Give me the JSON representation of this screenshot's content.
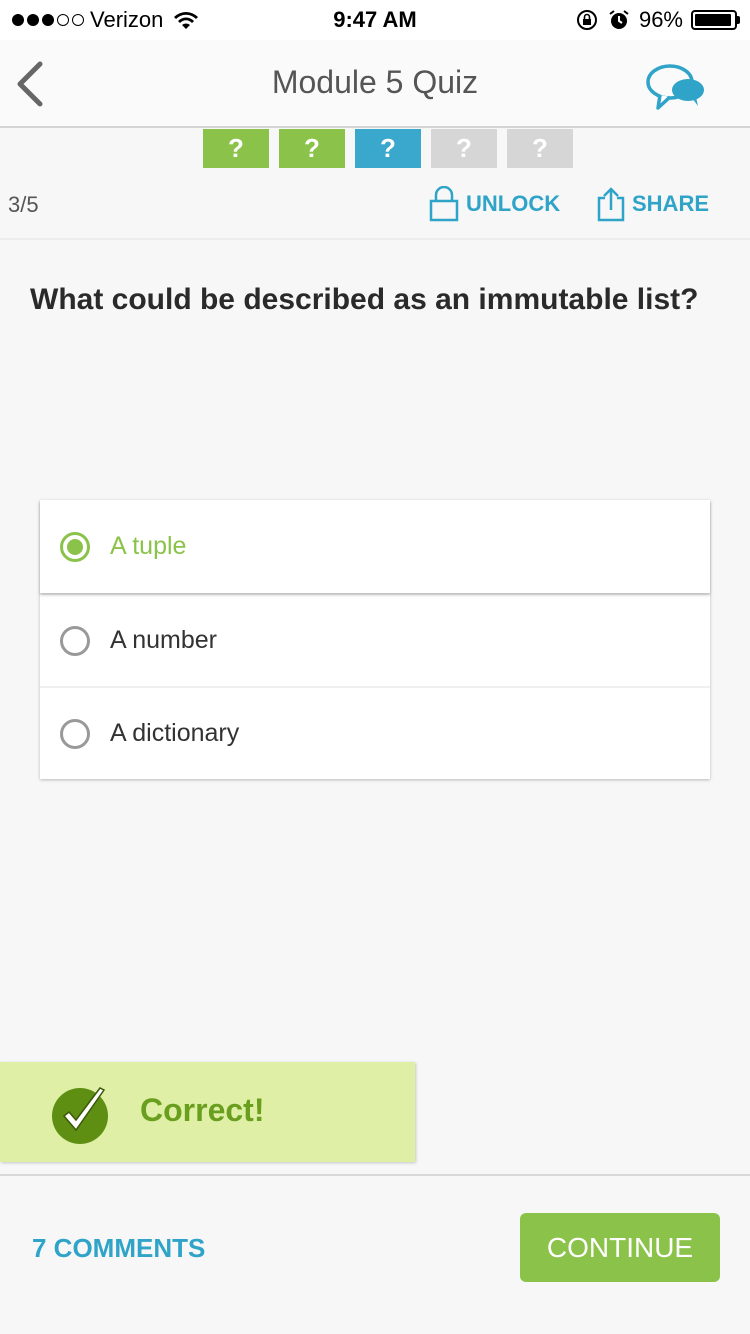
{
  "status_bar": {
    "carrier": "Verizon",
    "signal_dots_filled": 3,
    "signal_dots_total": 5,
    "time": "9:47 AM",
    "battery": "96%",
    "battery_level": 0.96
  },
  "nav": {
    "title": "Module 5 Quiz",
    "back_icon": "chevron-left-icon",
    "chat_icon": "chat-bubbles-icon"
  },
  "progress": [
    {
      "label": "?",
      "state": "correct",
      "color": "#8bc34a"
    },
    {
      "label": "?",
      "state": "correct",
      "color": "#8bc34a"
    },
    {
      "label": "?",
      "state": "current",
      "color": "#3aa7cc"
    },
    {
      "label": "?",
      "state": "unanswered",
      "color": "#d6d6d6"
    },
    {
      "label": "?",
      "state": "unanswered",
      "color": "#d6d6d6"
    }
  ],
  "info": {
    "counter": "3/5",
    "unlock_label": "UNLOCK",
    "share_label": "SHARE"
  },
  "question": {
    "text": "What could be described as an immutable list?"
  },
  "options": [
    {
      "label": "A tuple",
      "selected": true,
      "correct": true
    },
    {
      "label": "A number",
      "selected": false,
      "correct": false
    },
    {
      "label": "A dictionary",
      "selected": false,
      "correct": false
    }
  ],
  "feedback": {
    "text": "Correct!",
    "icon": "checkmark-circle-icon"
  },
  "footer": {
    "comments_label": "7 COMMENTS",
    "continue_label": "CONTINUE"
  },
  "colors": {
    "accent_green": "#8bc34a",
    "accent_blue": "#2fa4c8",
    "banner_bg": "#dff0a6"
  }
}
